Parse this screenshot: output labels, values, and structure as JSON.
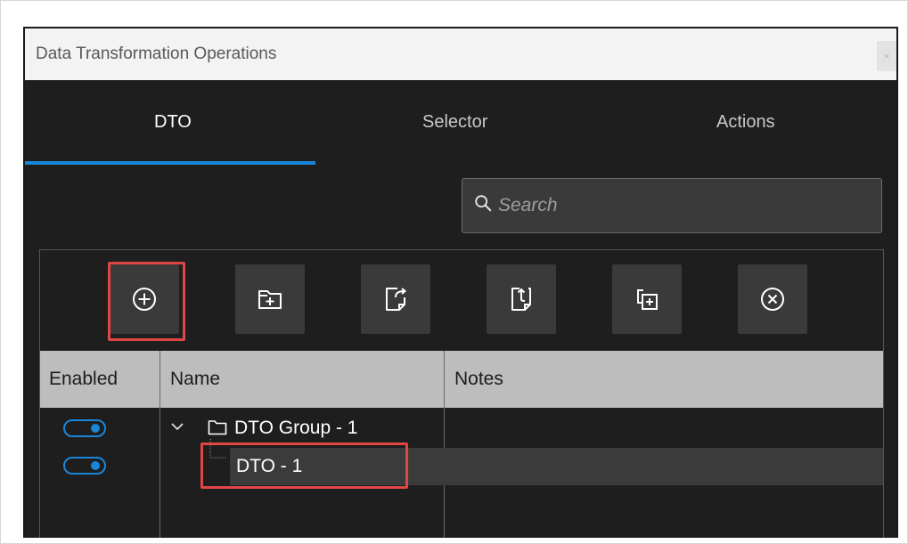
{
  "window": {
    "title": "Data Transformation Operations",
    "close_glyph": "×"
  },
  "tabs": [
    {
      "label": "DTO",
      "active": true
    },
    {
      "label": "Selector",
      "active": false
    },
    {
      "label": "Actions",
      "active": false
    }
  ],
  "search": {
    "placeholder": "Search"
  },
  "toolbar": {
    "buttons": [
      {
        "icon": "add-circle-icon",
        "highlighted": true
      },
      {
        "icon": "add-folder-icon",
        "highlighted": false
      },
      {
        "icon": "export-icon",
        "highlighted": false
      },
      {
        "icon": "import-icon",
        "highlighted": false
      },
      {
        "icon": "duplicate-icon",
        "highlighted": false
      },
      {
        "icon": "delete-circle-icon",
        "highlighted": false
      }
    ]
  },
  "grid": {
    "columns": [
      "Enabled",
      "Name",
      "Notes"
    ],
    "rows": [
      {
        "enabled": true,
        "name": "DTO Group - 1",
        "type": "group",
        "expanded": true,
        "notes": ""
      },
      {
        "enabled": true,
        "name": "DTO - 1",
        "type": "item",
        "selected": true,
        "notes": ""
      }
    ]
  },
  "colors": {
    "accent": "#1a86d8",
    "highlight": "#e04646",
    "background": "#1e1e1e"
  }
}
